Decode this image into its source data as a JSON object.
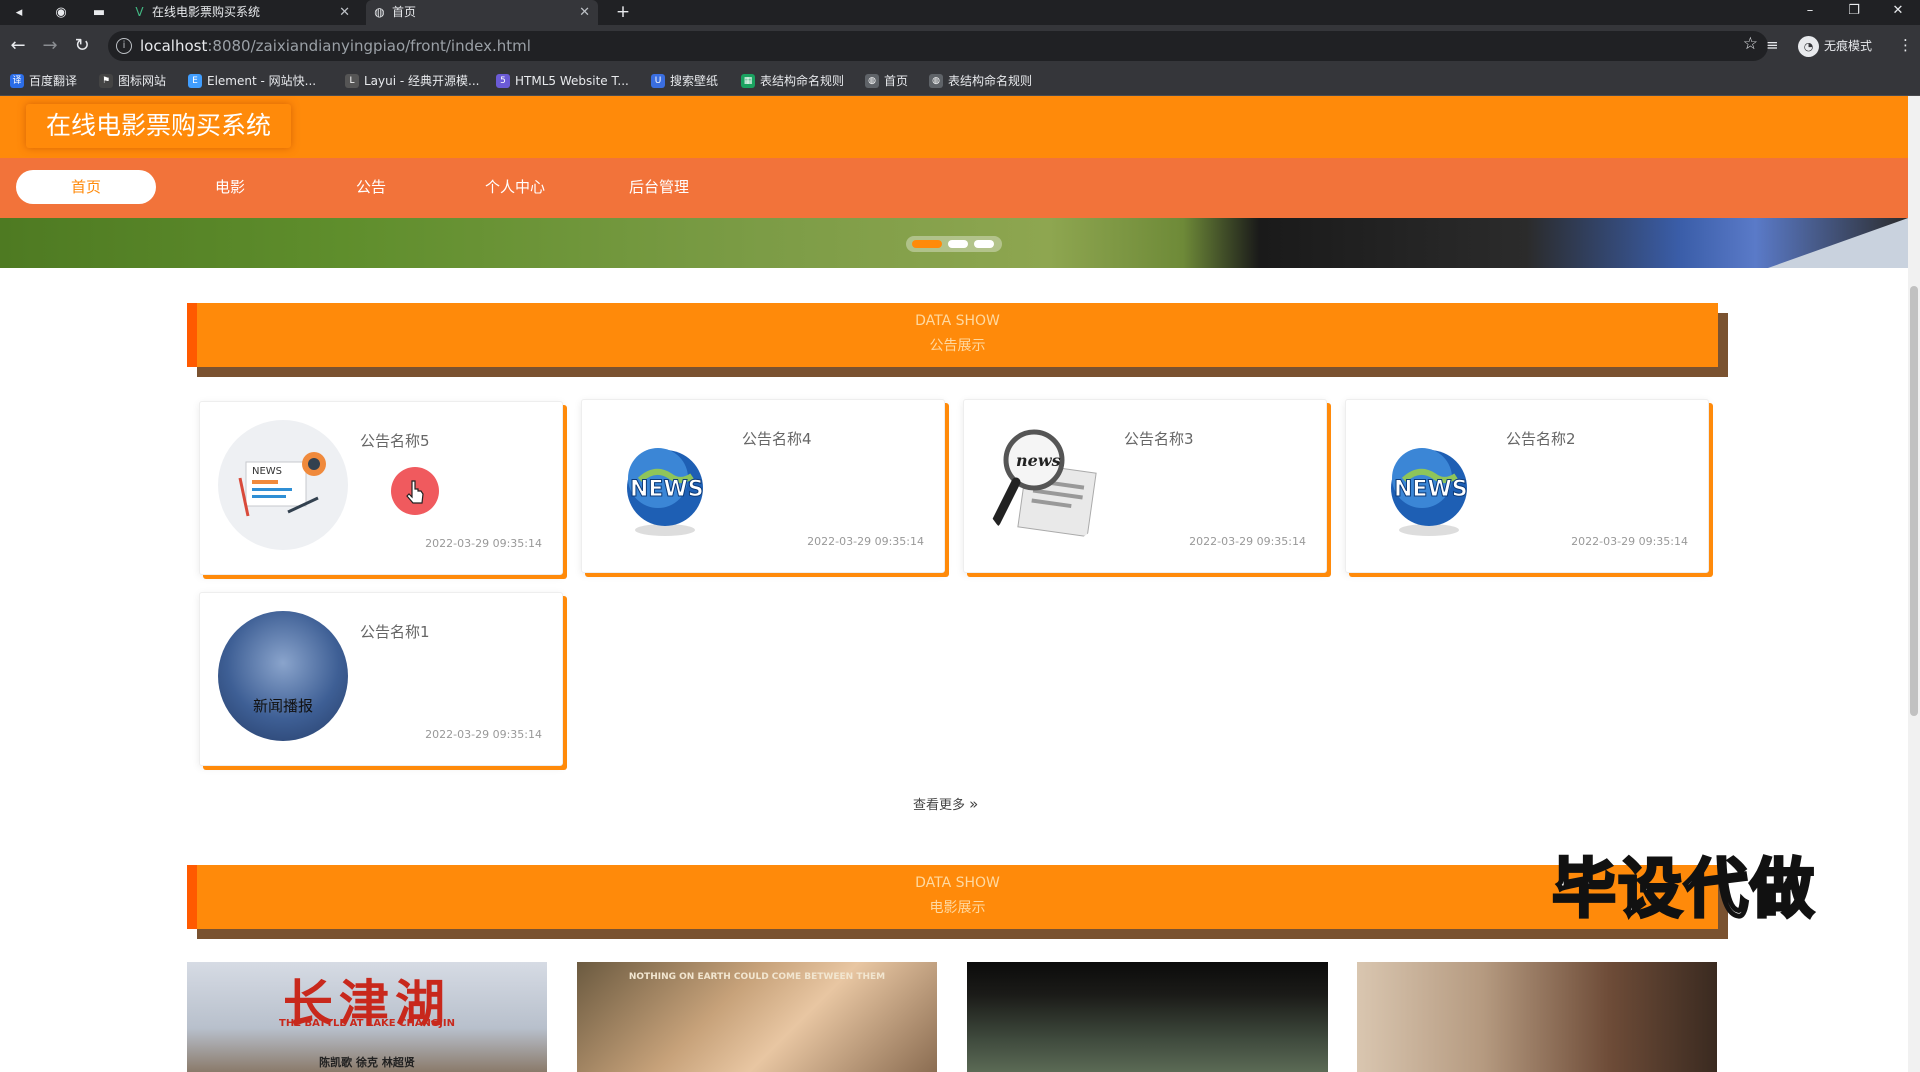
{
  "browser": {
    "tabs": [
      {
        "title": "在线电影票购买系统"
      },
      {
        "title": "首页"
      }
    ],
    "url_host": "localhost",
    "url_path": ":8080/zaixiandianyingpiao/front/index.html",
    "incognito_label": "无痕模式",
    "bookmarks": [
      {
        "label": "百度翻译",
        "color": "#2b6de8"
      },
      {
        "label": "图标网站",
        "color": "#444444"
      },
      {
        "label": "Element - 网站快...",
        "color": "#409eff"
      },
      {
        "label": "Layui - 经典开源模...",
        "color": "#555555"
      },
      {
        "label": "HTML5 Website T...",
        "color": "#6b5bd6"
      },
      {
        "label": "搜索壁纸",
        "color": "#3a6ee0"
      },
      {
        "label": "表结构命名规则",
        "color": "#1aa260"
      },
      {
        "label": "首页",
        "color": "#5f6368"
      },
      {
        "label": "表结构命名规则",
        "color": "#5f6368"
      }
    ]
  },
  "site": {
    "title": "在线电影票购买系统",
    "nav": [
      "首页",
      "电影",
      "公告",
      "个人中心",
      "后台管理"
    ],
    "active_nav": "首页"
  },
  "carousel": {
    "slide_count": 3,
    "active_index": 0
  },
  "notice_section": {
    "en": "DATA SHOW",
    "cn": "公告展示"
  },
  "notices": [
    {
      "title": "公告名称5",
      "time": "2022-03-29 09:35:14",
      "image": "news-illustration-icon"
    },
    {
      "title": "公告名称4",
      "time": "2022-03-29 09:35:14",
      "image": "news-globe-icon"
    },
    {
      "title": "公告名称3",
      "time": "2022-03-29 09:35:14",
      "image": "magnifier-newspaper-icon"
    },
    {
      "title": "公告名称2",
      "time": "2022-03-29 09:35:14",
      "image": "news-globe-icon"
    },
    {
      "title": "公告名称1",
      "time": "2022-03-29 09:35:14",
      "image": "news-broadcast-icon",
      "image_text": "新闻播报"
    }
  ],
  "more_label": "查看更多",
  "movie_section": {
    "en": "DATA SHOW",
    "cn": "电影展示"
  },
  "posters": [
    {
      "text": "长津湖",
      "subtext": "THE BATTLE AT LAKE CHANGJIN",
      "cast": "陈凯歌 徐克 林超贤"
    },
    {
      "text": "",
      "subtext": "NOTHING ON EARTH COULD COME BETWEEN THEM",
      "cast": ""
    },
    {
      "text": "",
      "subtext": "",
      "cast": ""
    },
    {
      "text": "",
      "subtext": "",
      "cast": ""
    }
  ],
  "watermark": "毕设代做",
  "colors": {
    "brand": "#ff8a0a",
    "nav": "#f2733a"
  }
}
